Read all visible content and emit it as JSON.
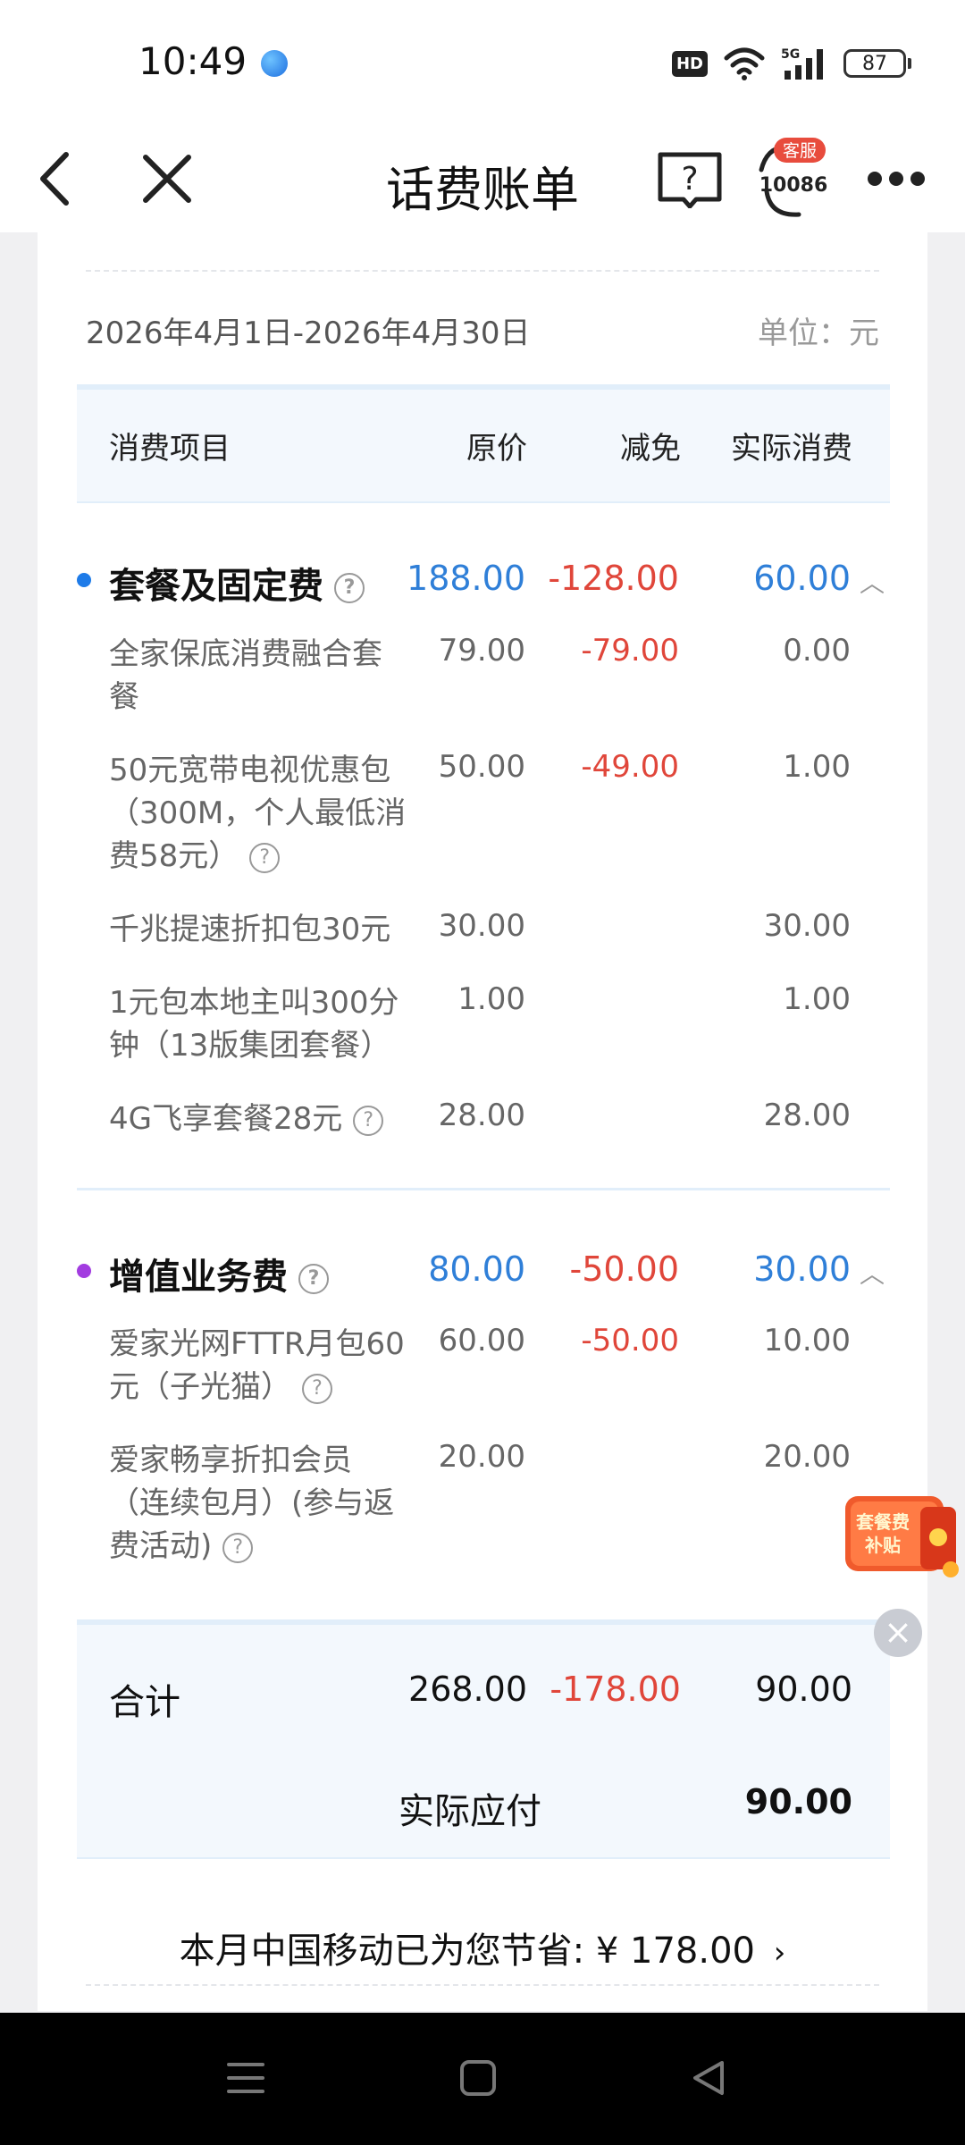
{
  "status": {
    "time": "10:49",
    "hd": "HD",
    "battery": "87",
    "network": "5G"
  },
  "nav": {
    "title": "话费账单",
    "service_badge": "客服",
    "service_number": "10086"
  },
  "bill": {
    "period": "2026年4月1日-2026年4月30日",
    "unit": "单位：元",
    "columns": {
      "item": "消费项目",
      "orig": "原价",
      "discount": "减免",
      "actual": "实际消费"
    },
    "sections": [
      {
        "title": "套餐及固定费",
        "dot_color": "#1e7be8",
        "orig": "188.00",
        "discount": "-128.00",
        "actual": "60.00",
        "items": [
          {
            "l1": "全家保底消费融合套",
            "l2": "餐",
            "l3": "",
            "orig": "79.00",
            "discount": "-79.00",
            "actual": "0.00"
          },
          {
            "l1": "50元宽带电视优惠包",
            "l2": "（300M，个人最低消",
            "l3": "费58元）",
            "orig": "50.00",
            "discount": "-49.00",
            "actual": "1.00"
          },
          {
            "l1": "千兆提速折扣包30元",
            "orig": "30.00",
            "discount": "",
            "actual": "30.00"
          },
          {
            "l1": "1元包本地主叫300分",
            "l2": "钟（13版集团套餐）",
            "orig": "1.00",
            "discount": "",
            "actual": "1.00"
          },
          {
            "l1": "4G飞享套餐28元",
            "orig": "28.00",
            "discount": "",
            "actual": "28.00"
          }
        ]
      },
      {
        "title": "增值业务费",
        "dot_color": "#a23ce0",
        "orig": "80.00",
        "discount": "-50.00",
        "actual": "30.00",
        "items": [
          {
            "l1": "爱家光网FTTR月包60",
            "l2": "元（子光猫）",
            "orig": "60.00",
            "discount": "-50.00",
            "actual": "10.00"
          },
          {
            "l1": "爱家畅享折扣会员",
            "l2": "（连续包月）(参与返",
            "l3": "费活动)",
            "orig": "20.00",
            "discount": "",
            "actual": "20.00"
          }
        ]
      }
    ],
    "total": {
      "label": "合计",
      "orig": "268.00",
      "discount": "-178.00",
      "actual": "90.00"
    },
    "payable": {
      "label": "实际应付",
      "value": "90.00"
    },
    "savings": "本月中国移动已为您节省: ¥ 178.00",
    "promo": {
      "line1": "套餐费",
      "line2": "补贴"
    }
  }
}
